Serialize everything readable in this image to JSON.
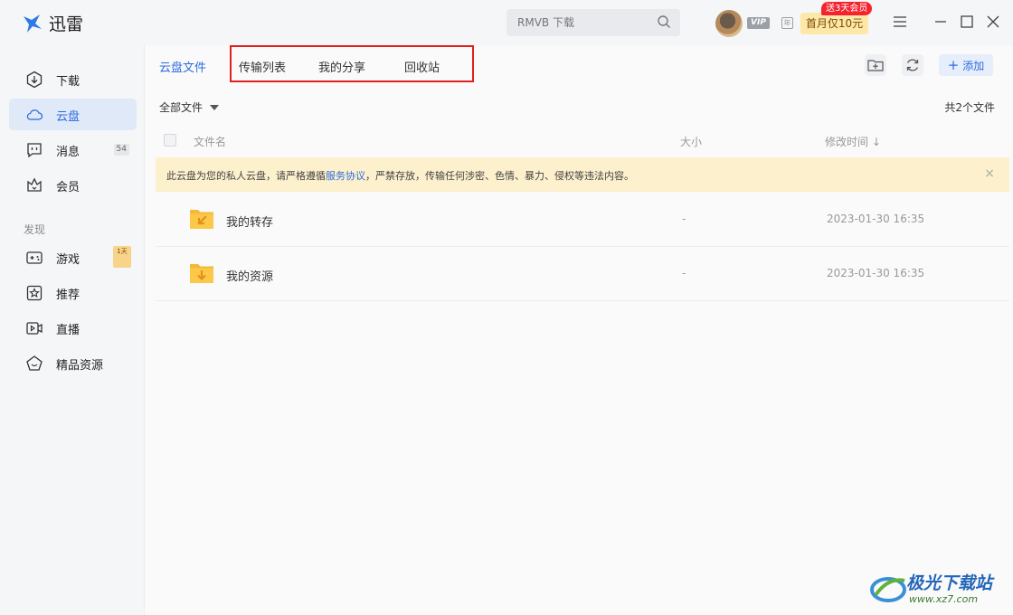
{
  "app": {
    "title": "迅雷"
  },
  "search": {
    "placeholder": "RMVB 下载"
  },
  "header": {
    "vip": "VIP",
    "year": "年",
    "promo_label": "首月仅10元",
    "promo_tag": "送3天会员"
  },
  "sidebar": {
    "items": [
      {
        "label": "下载",
        "icon": "download-icon"
      },
      {
        "label": "云盘",
        "icon": "cloud-icon",
        "active": true
      },
      {
        "label": "消息",
        "icon": "message-icon",
        "count": "54"
      },
      {
        "label": "会员",
        "icon": "crown-icon"
      }
    ],
    "section_label": "发现",
    "discover": [
      {
        "label": "游戏",
        "icon": "gamepad-icon",
        "badge": "1天"
      },
      {
        "label": "推荐",
        "icon": "star-icon"
      },
      {
        "label": "直播",
        "icon": "live-icon"
      },
      {
        "label": "精品资源",
        "icon": "gem-icon"
      }
    ]
  },
  "tabs": [
    {
      "label": "云盘文件",
      "active": true
    },
    {
      "label": "传输列表"
    },
    {
      "label": "我的分享"
    },
    {
      "label": "回收站"
    }
  ],
  "toolbar": {
    "add_label": "添加"
  },
  "filter": {
    "label": "全部文件"
  },
  "file_count": "共2个文件",
  "table": {
    "columns": [
      "文件名",
      "大小",
      "修改时间"
    ],
    "rows": [
      {
        "name": "我的转存",
        "size": "-",
        "time": "2023-01-30 16:35"
      },
      {
        "name": "我的资源",
        "size": "-",
        "time": "2023-01-30 16:35"
      }
    ]
  },
  "notice": {
    "prefix": "此云盘为您的私人云盘，请严格遵循",
    "link": "服务协议",
    "suffix": "，严禁存放，传输任何涉密、色情、暴力、侵权等违法内容。"
  },
  "watermark": {
    "title": "极光下载站",
    "url": "www.xz7.com"
  },
  "colors": {
    "accent": "#2e6ce0",
    "notice_bg": "#fdf0cc",
    "highlight": "#e02020",
    "promo": "#fde8a8"
  }
}
